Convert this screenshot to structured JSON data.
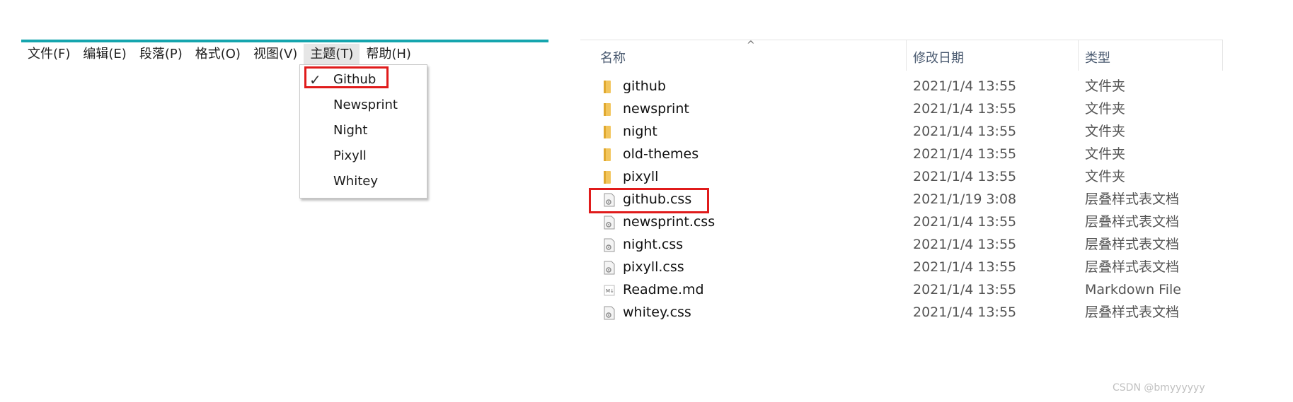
{
  "menubar": {
    "items": [
      {
        "label": "文件(F)"
      },
      {
        "label": "编辑(E)"
      },
      {
        "label": "段落(P)"
      },
      {
        "label": "格式(O)"
      },
      {
        "label": "视图(V)"
      },
      {
        "label": "主题(T)"
      },
      {
        "label": "帮助(H)"
      }
    ]
  },
  "theme_menu": {
    "items": [
      {
        "label": "Github",
        "checked": true
      },
      {
        "label": "Newsprint"
      },
      {
        "label": "Night"
      },
      {
        "label": "Pixyll"
      },
      {
        "label": "Whitey"
      }
    ]
  },
  "explorer": {
    "headers": {
      "name": "名称",
      "date": "修改日期",
      "type": "类型"
    },
    "rows": [
      {
        "name": "github",
        "date": "2021/1/4 13:55",
        "type": "文件夹",
        "icon": "folder-icon"
      },
      {
        "name": "newsprint",
        "date": "2021/1/4 13:55",
        "type": "文件夹",
        "icon": "folder-icon"
      },
      {
        "name": "night",
        "date": "2021/1/4 13:55",
        "type": "文件夹",
        "icon": "folder-icon"
      },
      {
        "name": "old-themes",
        "date": "2021/1/4 13:55",
        "type": "文件夹",
        "icon": "folder-icon"
      },
      {
        "name": "pixyll",
        "date": "2021/1/4 13:55",
        "type": "文件夹",
        "icon": "folder-icon"
      },
      {
        "name": "github.css",
        "date": "2021/1/19 3:08",
        "type": "层叠样式表文档",
        "icon": "css-file-icon"
      },
      {
        "name": "newsprint.css",
        "date": "2021/1/4 13:55",
        "type": "层叠样式表文档",
        "icon": "css-file-icon"
      },
      {
        "name": "night.css",
        "date": "2021/1/4 13:55",
        "type": "层叠样式表文档",
        "icon": "css-file-icon"
      },
      {
        "name": "pixyll.css",
        "date": "2021/1/4 13:55",
        "type": "层叠样式表文档",
        "icon": "css-file-icon"
      },
      {
        "name": "Readme.md",
        "date": "2021/1/4 13:55",
        "type": "Markdown File",
        "icon": "markdown-file-icon"
      },
      {
        "name": "whitey.css",
        "date": "2021/1/4 13:55",
        "type": "层叠样式表文档",
        "icon": "css-file-icon"
      }
    ]
  },
  "watermark": "CSDN @bmyyyyyy",
  "colors": {
    "accent": "#15a5ae",
    "highlight": "#e01b1b",
    "folder": "#f2c55c"
  }
}
